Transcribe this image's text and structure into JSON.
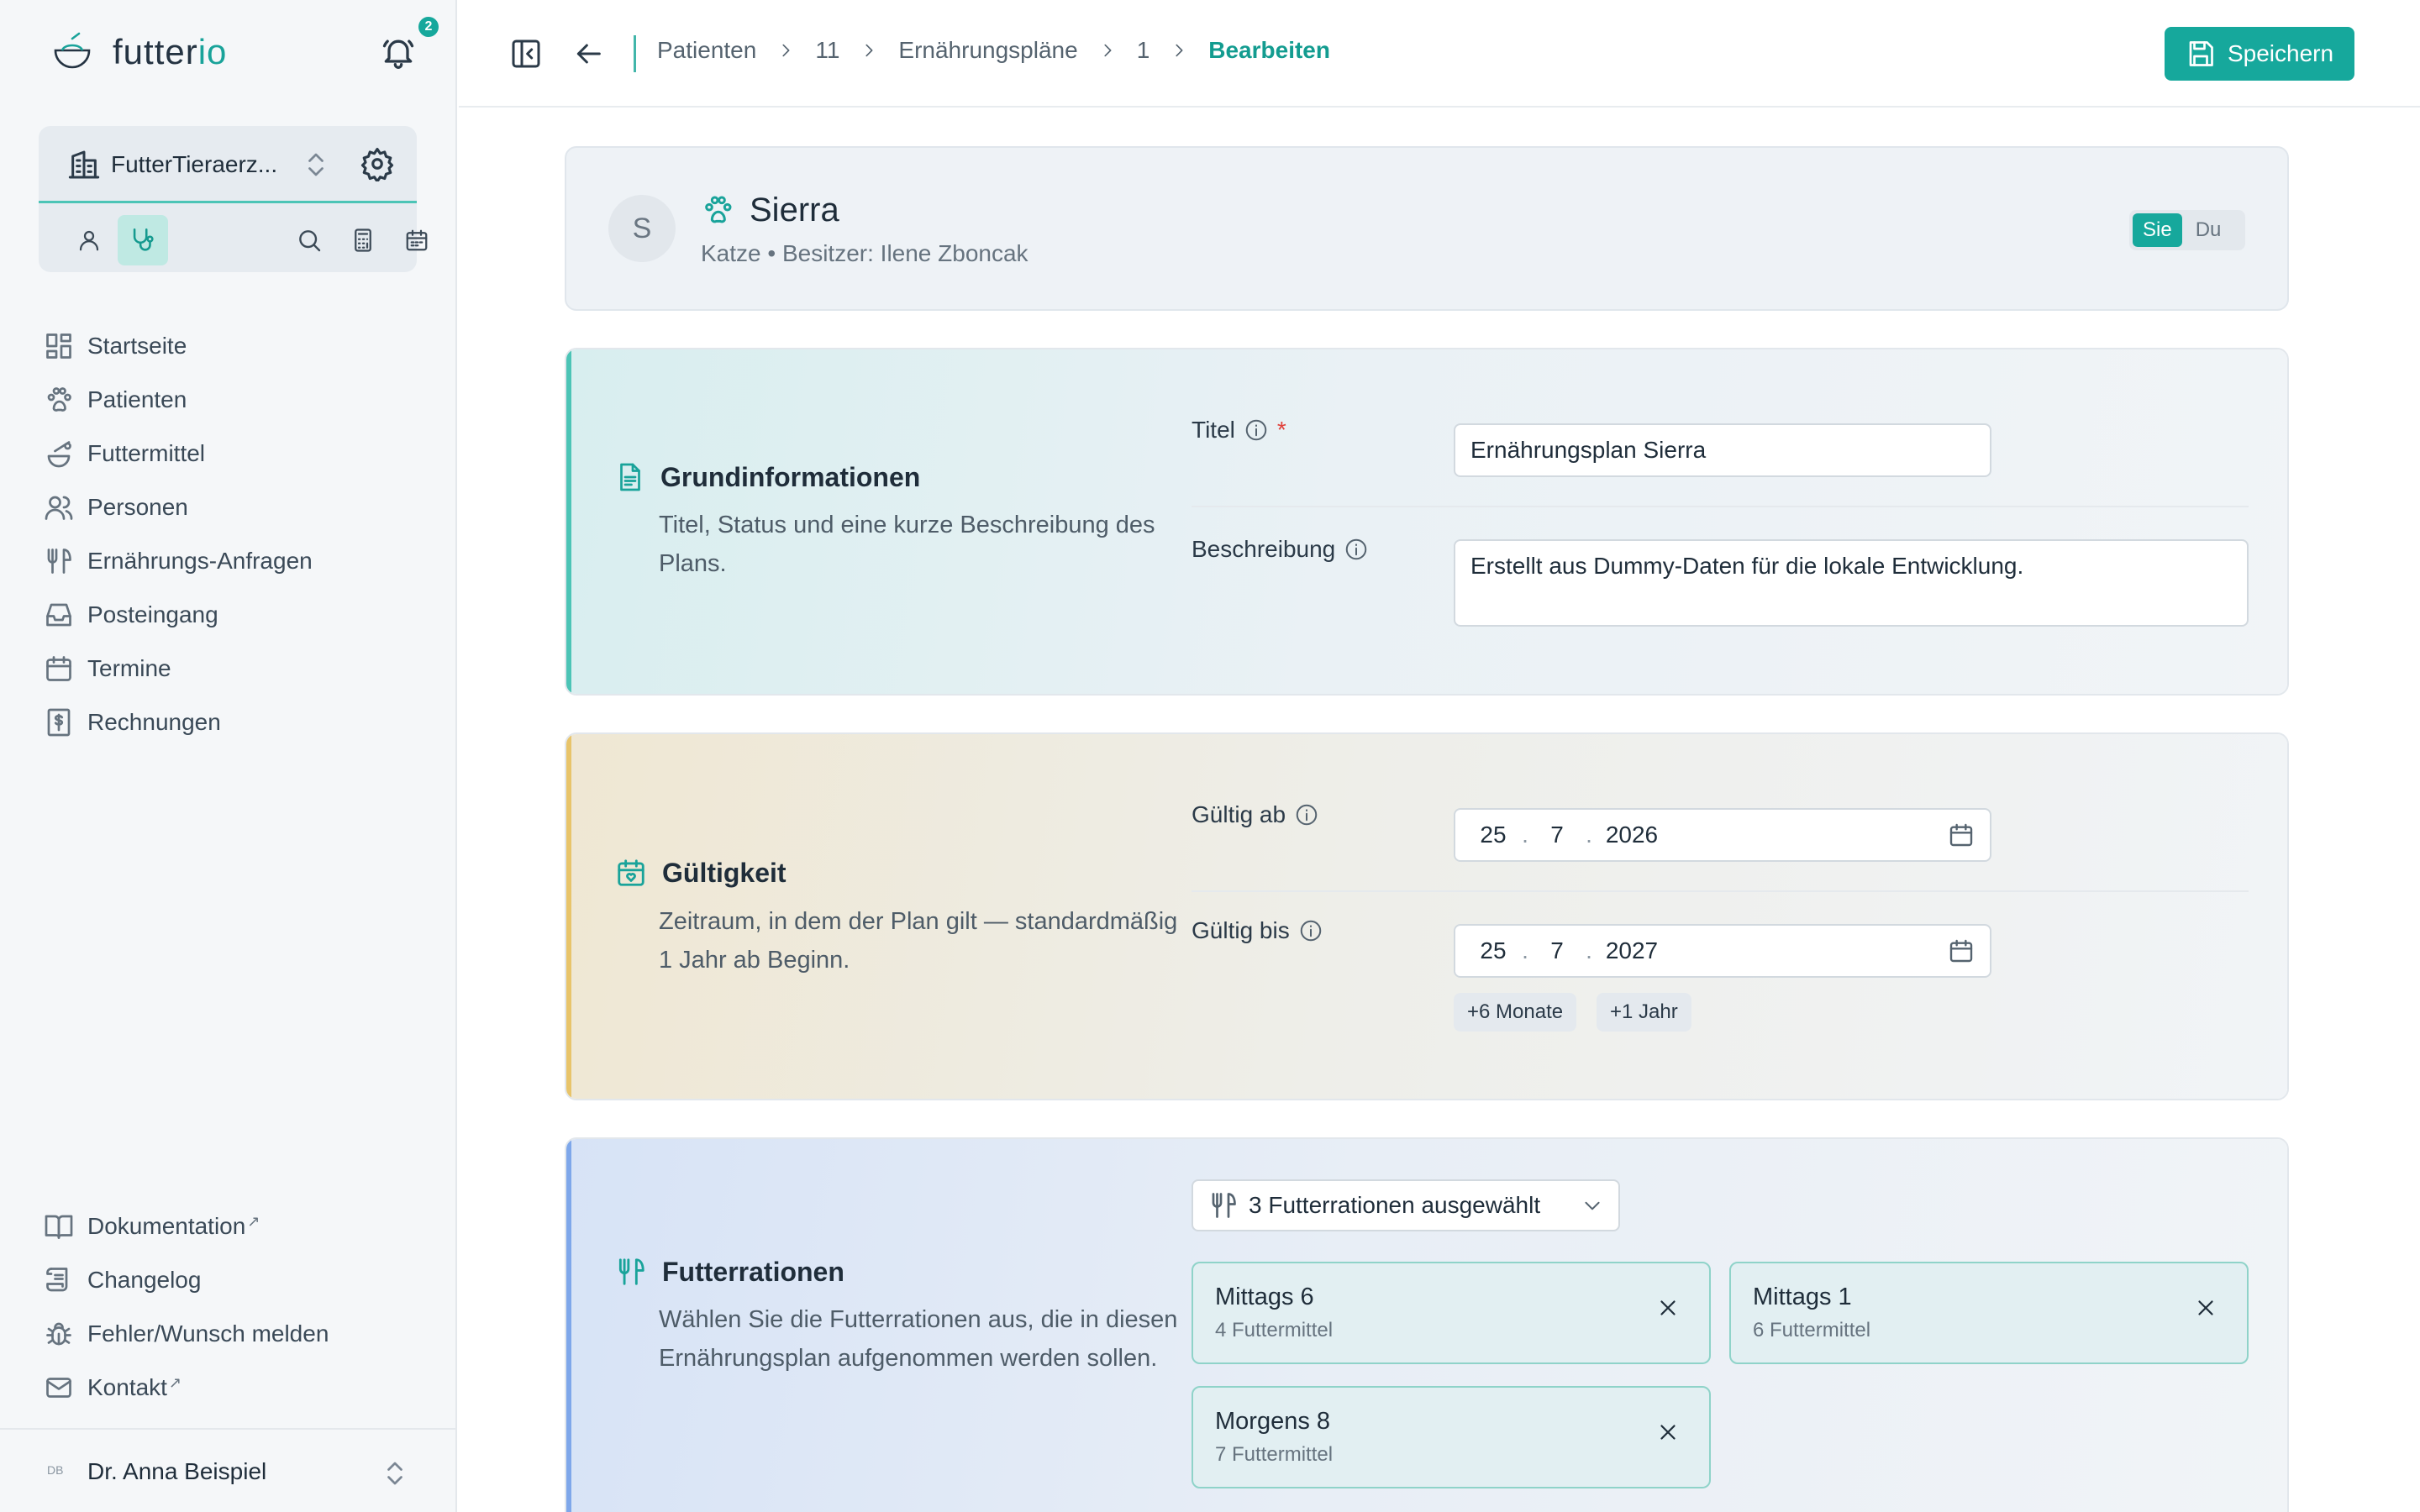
{
  "app": {
    "brand_prefix": "futter",
    "brand_suffix": "io",
    "notification_count": "2"
  },
  "clinic": {
    "name": "FutterTieraerz..."
  },
  "nav": {
    "items": [
      {
        "label": "Startseite",
        "icon": "dashboard-icon"
      },
      {
        "label": "Patienten",
        "icon": "paw-icon"
      },
      {
        "label": "Futtermittel",
        "icon": "food-icon"
      },
      {
        "label": "Personen",
        "icon": "people-icon"
      },
      {
        "label": "Ernährungs-Anfragen",
        "icon": "utensils-icon"
      },
      {
        "label": "Posteingang",
        "icon": "inbox-icon"
      },
      {
        "label": "Termine",
        "icon": "calendar-icon"
      },
      {
        "label": "Rechnungen",
        "icon": "invoice-icon"
      }
    ],
    "bottom": [
      {
        "label": "Dokumentation",
        "icon": "book-icon",
        "external": true
      },
      {
        "label": "Changelog",
        "icon": "scroll-icon",
        "external": false
      },
      {
        "label": "Fehler/Wunsch melden",
        "icon": "bug-icon",
        "external": false
      },
      {
        "label": "Kontakt",
        "icon": "mail-icon",
        "external": true
      }
    ],
    "external_mark": "↗"
  },
  "user": {
    "initials": "DB",
    "name": "Dr. Anna Beispiel"
  },
  "breadcrumb": [
    "Patienten",
    "11",
    "Ernährungspläne",
    "1",
    "Bearbeiten"
  ],
  "toolbar": {
    "save_label": "Speichern"
  },
  "patient": {
    "initial": "S",
    "name": "Sierra",
    "subtitle": "Katze • Besitzer: Ilene Zboncak",
    "address_modes": [
      "Sie",
      "Du"
    ],
    "address_active": "Sie"
  },
  "basics": {
    "title": "Grundinformationen",
    "description": "Titel, Status und eine kurze Beschreibung des Plans.",
    "title_label": "Titel",
    "title_value": "Ernährungsplan Sierra",
    "desc_label": "Beschreibung",
    "desc_value": "Erstellt aus Dummy-Daten für die lokale Entwicklung."
  },
  "validity": {
    "title": "Gültigkeit",
    "description": "Zeitraum, in dem der Plan gilt — standardmäßig 1 Jahr ab Beginn.",
    "from_label": "Gültig ab",
    "from": {
      "day": "25",
      "month": "7",
      "year": "2026"
    },
    "to_label": "Gültig bis",
    "to": {
      "day": "25",
      "month": "7",
      "year": "2027"
    },
    "date_sep": ".",
    "quick_add": [
      "+6 Monate",
      "+1 Jahr"
    ]
  },
  "rations": {
    "title": "Futterrationen",
    "description": "Wählen Sie die Futterrationen aus, die in diesen Ernährungsplan aufgenommen werden sollen.",
    "select_label": "3 Futterrationen ausgewählt",
    "items": [
      {
        "name": "Mittags 6",
        "sub": "4 Futtermittel"
      },
      {
        "name": "Mittags 1",
        "sub": "6 Futtermittel"
      },
      {
        "name": "Morgens 8",
        "sub": "7 Futtermittel"
      }
    ]
  },
  "colors": {
    "accent": "#16a89c",
    "basics_stripe": "#4cc4b6",
    "validity_stripe": "#e8c46a",
    "rations_stripe": "#7ea7ea"
  }
}
